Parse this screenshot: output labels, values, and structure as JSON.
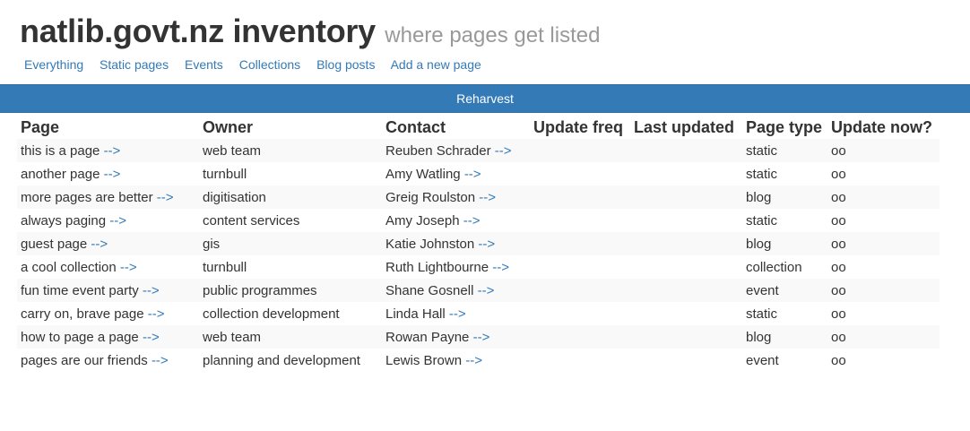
{
  "header": {
    "title": "natlib.govt.nz inventory",
    "subtitle": "where pages get listed"
  },
  "nav": {
    "items": [
      "Everything",
      "Static pages",
      "Events",
      "Collections",
      "Blog posts",
      "Add a new page"
    ]
  },
  "reharvest": {
    "label": "Reharvest"
  },
  "table": {
    "arrow": "-->",
    "columns": [
      "Page",
      "Owner",
      "Contact",
      "Update freq",
      "Last updated",
      "Page type",
      "Update now?"
    ],
    "rows": [
      {
        "page": "this is a page",
        "owner": "web team",
        "contact": "Reuben Schrader",
        "freq": "",
        "last": "",
        "type": "static",
        "update": "oo"
      },
      {
        "page": "another page",
        "owner": "turnbull",
        "contact": "Amy Watling",
        "freq": "",
        "last": "",
        "type": "static",
        "update": "oo"
      },
      {
        "page": "more pages are better",
        "owner": "digitisation",
        "contact": "Greig Roulston",
        "freq": "",
        "last": "",
        "type": "blog",
        "update": "oo"
      },
      {
        "page": "always paging",
        "owner": "content services",
        "contact": "Amy Joseph",
        "freq": "",
        "last": "",
        "type": "static",
        "update": "oo"
      },
      {
        "page": "guest page",
        "owner": "gis",
        "contact": "Katie Johnston",
        "freq": "",
        "last": "",
        "type": "blog",
        "update": "oo"
      },
      {
        "page": "a cool collection",
        "owner": "turnbull",
        "contact": "Ruth Lightbourne",
        "freq": "",
        "last": "",
        "type": "collection",
        "update": "oo"
      },
      {
        "page": "fun time event party",
        "owner": "public programmes",
        "contact": "Shane Gosnell",
        "freq": "",
        "last": "",
        "type": "event",
        "update": "oo"
      },
      {
        "page": "carry on, brave page",
        "owner": "collection development",
        "contact": "Linda Hall",
        "freq": "",
        "last": "",
        "type": "static",
        "update": "oo"
      },
      {
        "page": "how to page a page",
        "owner": "web team",
        "contact": "Rowan Payne",
        "freq": "",
        "last": "",
        "type": "blog",
        "update": "oo"
      },
      {
        "page": "pages are our friends",
        "owner": "planning and development",
        "contact": "Lewis Brown",
        "freq": "",
        "last": "",
        "type": "event",
        "update": "oo"
      }
    ]
  },
  "colors": {
    "accent": "#337ab7",
    "subtitle": "#999999",
    "text": "#333333",
    "row_stripe": "#f9f9f9"
  }
}
